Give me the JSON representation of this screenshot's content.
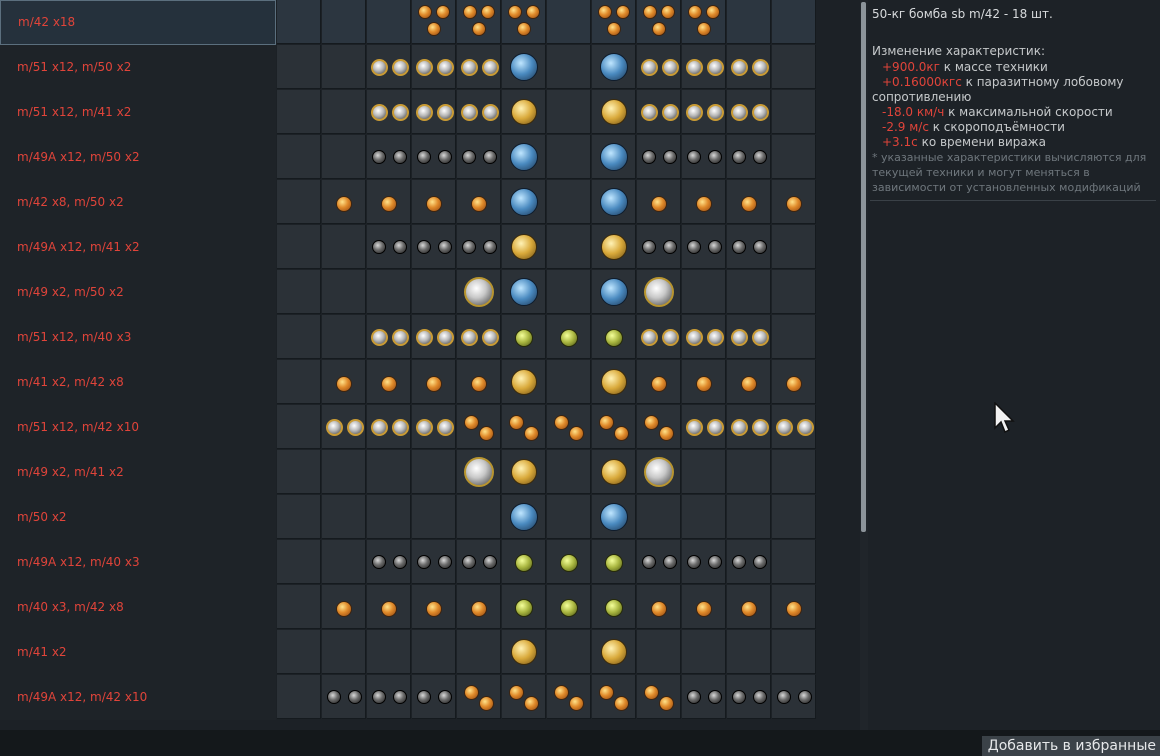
{
  "rows": [
    {
      "label": "m/42 x18",
      "selected": true,
      "slots": [
        "",
        "",
        "",
        "orange_tri",
        "orange_tri",
        "orange_tri",
        "",
        "orange_tri",
        "orange_tri",
        "orange_tri",
        "",
        ""
      ]
    },
    {
      "label": "m/51 x12,  m/50 x2",
      "slots": [
        "",
        "",
        "silver_pair",
        "silver_pair",
        "silver_pair",
        "blue",
        "",
        "blue",
        "silver_pair",
        "silver_pair",
        "silver_pair",
        ""
      ]
    },
    {
      "label": "m/51 x12,  m/41 x2",
      "slots": [
        "",
        "",
        "silver_pair",
        "silver_pair",
        "silver_pair",
        "gold",
        "",
        "gold",
        "silver_pair",
        "silver_pair",
        "silver_pair",
        ""
      ]
    },
    {
      "label": "m/49A x12,  m/50 x2",
      "slots": [
        "",
        "",
        "dark_pair",
        "dark_pair",
        "dark_pair",
        "blue",
        "",
        "blue",
        "dark_pair",
        "dark_pair",
        "dark_pair",
        ""
      ]
    },
    {
      "label": "m/42 x8,  m/50 x2",
      "slots": [
        "",
        "orange",
        "orange",
        "orange",
        "orange",
        "blue",
        "",
        "blue",
        "orange",
        "orange",
        "orange",
        "orange"
      ]
    },
    {
      "label": "m/49A x12,  m/41 x2",
      "slots": [
        "",
        "",
        "dark_pair",
        "dark_pair",
        "dark_pair",
        "gold",
        "",
        "gold",
        "dark_pair",
        "dark_pair",
        "dark_pair",
        ""
      ]
    },
    {
      "label": "m/49 x2,  m/50 x2",
      "slots": [
        "",
        "",
        "",
        "",
        "big",
        "blue",
        "",
        "blue",
        "big",
        "",
        "",
        ""
      ]
    },
    {
      "label": "m/51 x12,  m/40 x3",
      "slots": [
        "",
        "",
        "silver_pair",
        "silver_pair",
        "silver_pair",
        "green",
        "green",
        "green",
        "silver_pair",
        "silver_pair",
        "silver_pair",
        ""
      ]
    },
    {
      "label": "m/41 x2,  m/42 x8",
      "slots": [
        "",
        "orange",
        "orange",
        "orange",
        "orange",
        "gold",
        "",
        "gold",
        "orange",
        "orange",
        "orange",
        "orange"
      ]
    },
    {
      "label": "m/51 x12,  m/42 x10",
      "slots": [
        "",
        "silver_pair",
        "silver_pair",
        "silver_pair",
        "orange_duo",
        "orange_duo",
        "orange_duo",
        "orange_duo",
        "orange_duo",
        "silver_pair",
        "silver_pair",
        "silver_pair"
      ]
    },
    {
      "label": "m/49 x2,  m/41 x2",
      "slots": [
        "",
        "",
        "",
        "",
        "big",
        "gold",
        "",
        "gold",
        "big",
        "",
        "",
        ""
      ]
    },
    {
      "label": "m/50 x2",
      "slots": [
        "",
        "",
        "",
        "",
        "",
        "blue",
        "",
        "blue",
        "",
        "",
        "",
        ""
      ]
    },
    {
      "label": "m/49A x12,  m/40 x3",
      "slots": [
        "",
        "",
        "dark_pair",
        "dark_pair",
        "dark_pair",
        "green",
        "green",
        "green",
        "dark_pair",
        "dark_pair",
        "dark_pair",
        ""
      ]
    },
    {
      "label": "m/40 x3,  m/42 x8",
      "slots": [
        "",
        "orange",
        "orange",
        "orange",
        "orange",
        "green",
        "green",
        "green",
        "orange",
        "orange",
        "orange",
        "orange"
      ]
    },
    {
      "label": "m/41 x2",
      "slots": [
        "",
        "",
        "",
        "",
        "",
        "gold",
        "",
        "gold",
        "",
        "",
        "",
        ""
      ]
    },
    {
      "label": "m/49A x12,  m/42 x10",
      "slots": [
        "",
        "dark_pair",
        "dark_pair",
        "dark_pair",
        "orange_duo",
        "orange_duo",
        "orange_duo",
        "orange_duo",
        "orange_duo",
        "dark_pair",
        "dark_pair",
        "dark_pair"
      ]
    }
  ],
  "info": {
    "title": "50-кг бомба sb m/42 - 18 шт.",
    "subtitle": "Изменение характеристик:",
    "changes": [
      {
        "value": "+900.0кг",
        "text": " к массе техники"
      },
      {
        "value": "+0.16000кгс",
        "text": " к паразитному лобовому"
      },
      {
        "value": "",
        "text": "сопротивлению"
      },
      {
        "value": "-18.0 км/ч",
        "text": " к максимальной скорости"
      },
      {
        "value": "-2.9 м/с",
        "text": " к скороподъёмности"
      },
      {
        "value": "+3.1с",
        "text": " ко времени виража"
      }
    ],
    "note": "* указанные характеристики вычисляются для текущей техники и могут меняться в зависимости от установленных модификаций"
  },
  "bottom": {
    "favorite_button": "Добавить в избранные"
  },
  "colors": {
    "label": "#e0443a",
    "value_negative": "#e0443a",
    "panel": "#1d2227"
  }
}
